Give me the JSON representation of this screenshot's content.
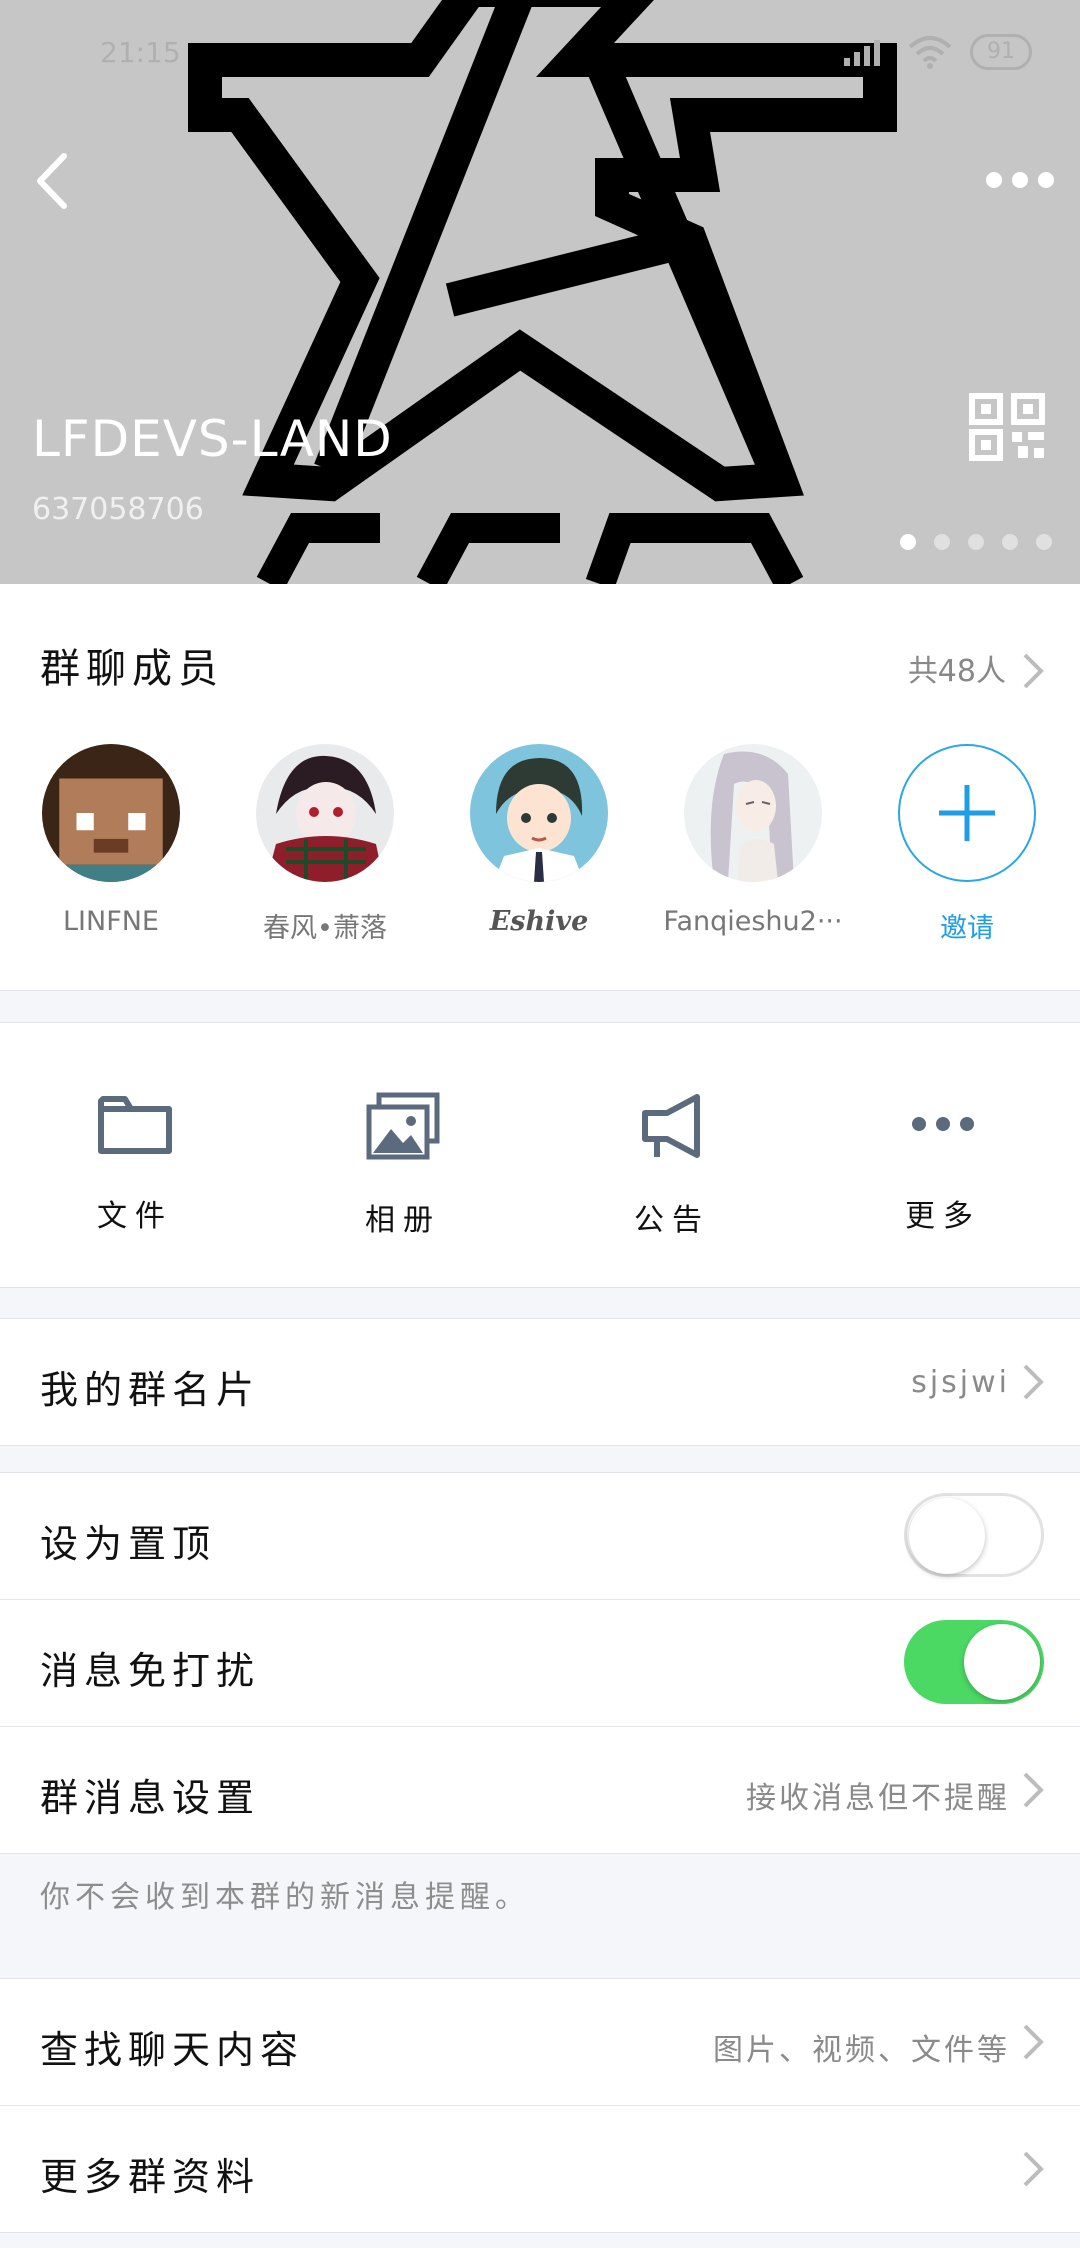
{
  "status_bar": {
    "time": "21:15",
    "battery": "91"
  },
  "header": {
    "group_name": "LFDEVS-LAND",
    "group_id": "637058706",
    "page_dots": 5,
    "active_dot": 0
  },
  "members": {
    "title": "群聊成员",
    "count": "共48人",
    "list": [
      {
        "name": "LINFNE"
      },
      {
        "name": "春风•萧落"
      },
      {
        "name": "Eshive"
      },
      {
        "name": "Fanqieshu2···"
      }
    ],
    "invite_label": "邀请"
  },
  "shortcuts": [
    {
      "label": "文件",
      "icon": "folder-icon"
    },
    {
      "label": "相册",
      "icon": "album-icon"
    },
    {
      "label": "公告",
      "icon": "megaphone-icon"
    },
    {
      "label": "更多",
      "icon": "more-dots-icon"
    }
  ],
  "my_card": {
    "label": "我的群名片",
    "value": "sjsjwi"
  },
  "pin": {
    "label": "设为置顶",
    "enabled": false
  },
  "dnd": {
    "label": "消息免打扰",
    "enabled": true
  },
  "msg_settings": {
    "label": "群消息设置",
    "value": "接收消息但不提醒"
  },
  "msg_note": "你不会收到本群的新消息提醒。",
  "search_history": {
    "label": "查找聊天内容",
    "value": "图片、视频、文件等"
  },
  "more_info": {
    "label": "更多群资料"
  },
  "colors": {
    "accent": "#1f9ee6",
    "toggle_on": "#4bd964",
    "cover_bg": "#c6c6c6"
  }
}
